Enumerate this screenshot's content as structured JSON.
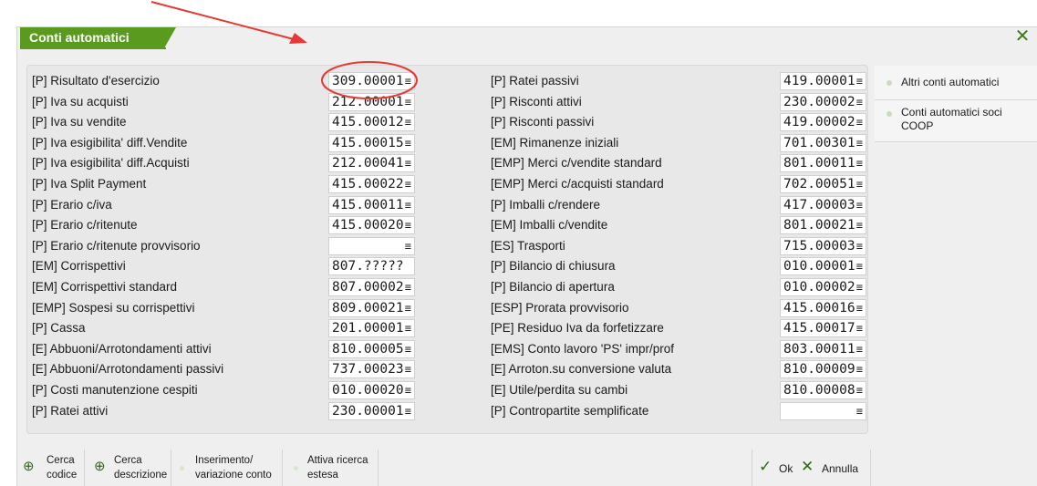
{
  "window": {
    "title": "Conti automatici",
    "close_glyph": "✕"
  },
  "fields_left": [
    {
      "label": "[P] Risultato d'esercizio",
      "value": "309.00001"
    },
    {
      "label": "[P] Iva su acquisti",
      "value": "212.00001"
    },
    {
      "label": "[P] Iva su vendite",
      "value": "415.00012"
    },
    {
      "label": "[P] Iva esigibilita' diff.Vendite",
      "value": "415.00015"
    },
    {
      "label": "[P] Iva esigibilita' diff.Acquisti",
      "value": "212.00041"
    },
    {
      "label": "[P] Iva Split Payment",
      "value": "415.00022"
    },
    {
      "label": "[P] Erario c/iva",
      "value": "415.00011"
    },
    {
      "label": "[P] Erario c/ritenute",
      "value": "415.00020"
    },
    {
      "label": "[P] Erario c/ritenute provvisorio",
      "value": ""
    },
    {
      "label": "[EM] Corrispettivi",
      "value": "807.?????"
    },
    {
      "label": "[EM] Corrispettivi standard",
      "value": "807.00002"
    },
    {
      "label": "[EMP] Sospesi su corrispettivi",
      "value": "809.00021"
    },
    {
      "label": "[P] Cassa",
      "value": "201.00001"
    },
    {
      "label": "[E] Abbuoni/Arrotondamenti attivi",
      "value": "810.00005"
    },
    {
      "label": "[E] Abbuoni/Arrotondamenti passivi",
      "value": "737.00023"
    },
    {
      "label": "[P] Costi manutenzione cespiti",
      "value": "010.00020"
    },
    {
      "label": "[P] Ratei attivi",
      "value": "230.00001"
    }
  ],
  "fields_right": [
    {
      "label": "[P] Ratei passivi",
      "value": "419.00001"
    },
    {
      "label": "[P] Risconti attivi",
      "value": "230.00002"
    },
    {
      "label": "[P] Risconti passivi",
      "value": "419.00002"
    },
    {
      "label": "[EM] Rimanenze iniziali",
      "value": "701.00301"
    },
    {
      "label": "[EMP] Merci c/vendite standard",
      "value": "801.00011"
    },
    {
      "label": "[EMP] Merci c/acquisti standard",
      "value": "702.00051"
    },
    {
      "label": "[P] Imballi c/rendere",
      "value": "417.00003"
    },
    {
      "label": "[EM] Imballi c/vendite",
      "value": "801.00021"
    },
    {
      "label": "[ES] Trasporti",
      "value": "715.00003"
    },
    {
      "label": "[P] Bilancio di chiusura",
      "value": "010.00001"
    },
    {
      "label": "[P] Bilancio di apertura",
      "value": "010.00002"
    },
    {
      "label": "[ESP] Prorata provvisorio",
      "value": "415.00016"
    },
    {
      "label": "[PE] Residuo Iva da forfetizzare",
      "value": "415.00017"
    },
    {
      "label": "[EMS] Conto lavoro 'PS' impr/prof",
      "value": "803.00011"
    },
    {
      "label": "[E] Arroton.su conversione valuta",
      "value": "810.00009"
    },
    {
      "label": "[E] Utile/perdita su cambi",
      "value": "810.00008"
    },
    {
      "label": "[P] Contropartite semplificate",
      "value": ""
    }
  ],
  "lookup_glyph": "≡",
  "sidebar": {
    "items": [
      {
        "label": "Altri conti automatici"
      },
      {
        "label": "Conti automatici soci COOP"
      }
    ]
  },
  "toolbar": {
    "cerca_codice": {
      "line1": "Cerca",
      "line2": "codice"
    },
    "cerca_descrizione": {
      "line1": "Cerca",
      "line2": "descrizione"
    },
    "inserimento": {
      "line1": "Inserimento/",
      "line2": "variazione conto"
    },
    "attiva_ricerca": {
      "line1": "Attiva ricerca",
      "line2": "estesa"
    },
    "ok": "Ok",
    "annulla": "Annulla",
    "ok_glyph": "✓",
    "annulla_glyph": "✕",
    "search_glyph": "⊕"
  },
  "colors": {
    "accent": "#5a9a1e",
    "annotation": "#e53935"
  }
}
